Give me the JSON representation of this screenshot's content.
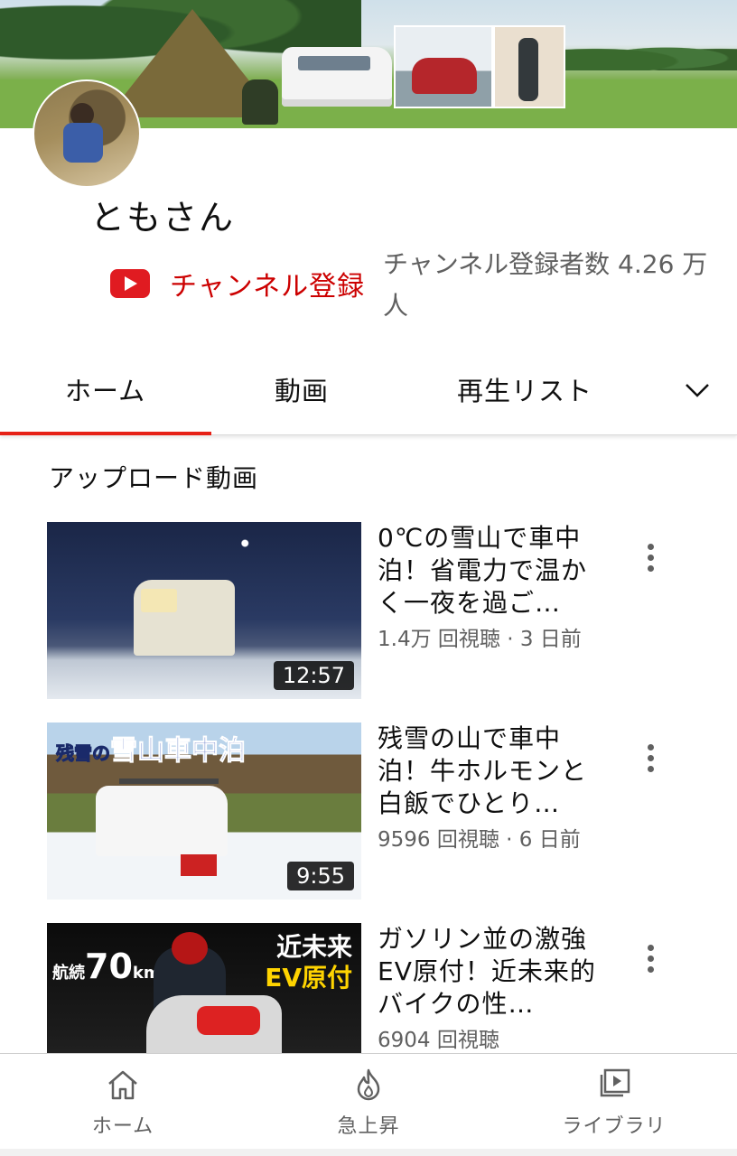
{
  "channel": {
    "name": "ともさん",
    "subscribe_label": "チャンネル登録",
    "subscriber_count": "チャンネル登録者数 4.26 万人"
  },
  "tabs": [
    {
      "label": "ホーム",
      "active": true
    },
    {
      "label": "動画",
      "active": false
    },
    {
      "label": "再生リスト",
      "active": false
    }
  ],
  "section": {
    "title": "アップロード動画"
  },
  "videos": [
    {
      "title": "0℃の雪山で車中泊！省電力で温かく一夜を過ご…",
      "meta": "1.4万 回視聴 · 3 日前",
      "duration": "12:57"
    },
    {
      "title": "残雪の山で車中泊！牛ホルモンと白飯でひとり…",
      "meta": "9596 回視聴 · 6 日前",
      "duration": "9:55",
      "thumb_text": {
        "prefix": "残雪の",
        "main": "雪山車中泊"
      }
    },
    {
      "title": "ガソリン並の激強EV原付！近未来的バイクの性…",
      "meta": "6904 回視聴",
      "thumb_text": {
        "range_label": "航続",
        "range_value": "70",
        "range_unit": "km",
        "line1": "近未来",
        "line2": "EV原付"
      }
    }
  ],
  "bottom_nav": [
    {
      "label": "ホーム",
      "icon": "home-icon"
    },
    {
      "label": "急上昇",
      "icon": "trending-flame-icon"
    },
    {
      "label": "ライブラリ",
      "icon": "library-icon"
    }
  ],
  "colors": {
    "brand_red": "#e01b21",
    "subscribe_text": "#cc0000",
    "tab_underline": "#e62117",
    "secondary_text": "#606060"
  }
}
